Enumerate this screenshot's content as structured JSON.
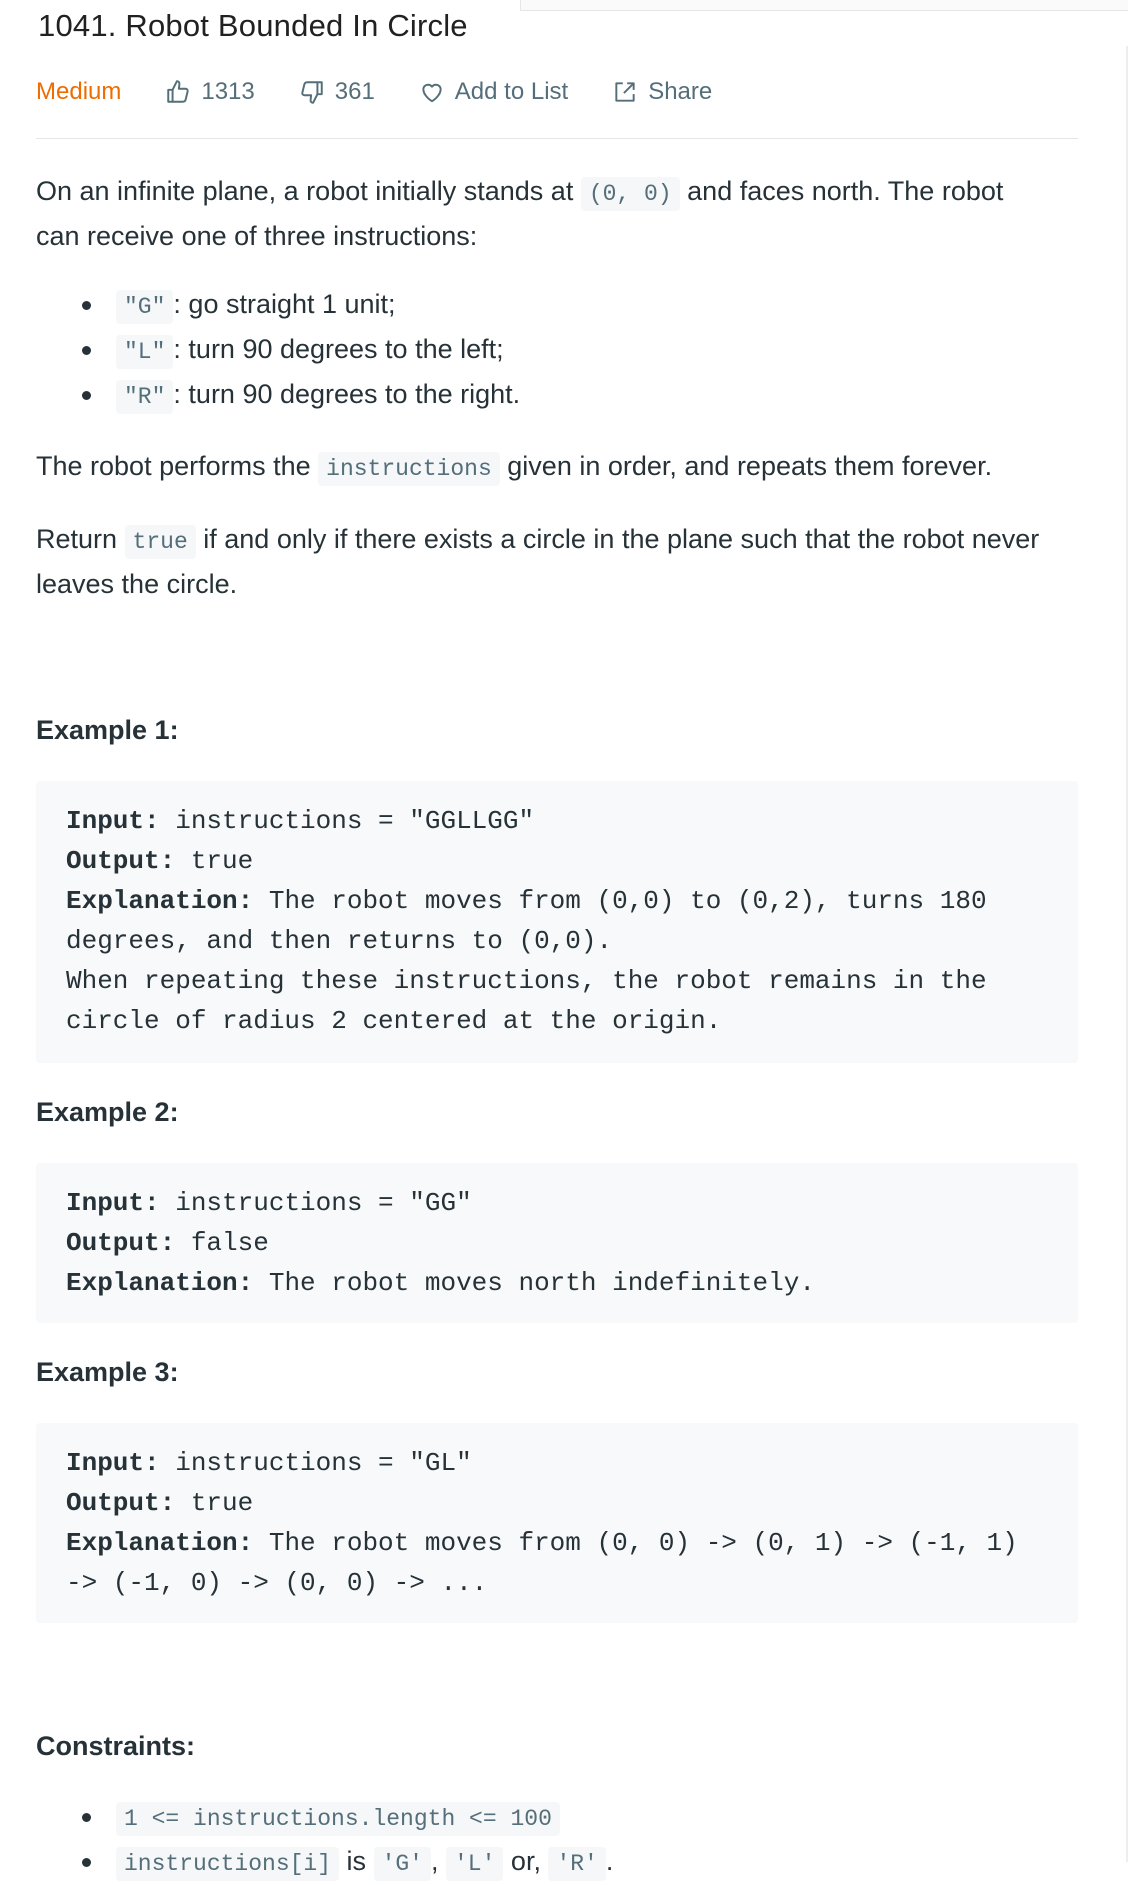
{
  "problem": {
    "title": "1041. Robot Bounded In Circle",
    "difficulty": "Medium",
    "likes": "1313",
    "dislikes": "361",
    "add_to_list": "Add to List",
    "share": "Share"
  },
  "description": {
    "p1_a": "On an infinite plane, a robot initially stands at ",
    "p1_code": "(0, 0)",
    "p1_b": " and faces north. The robot can receive one of three instructions:",
    "instructions": [
      {
        "code": "\"G\"",
        "text": ": go straight 1 unit;"
      },
      {
        "code": "\"L\"",
        "text": ": turn 90 degrees to the left;"
      },
      {
        "code": "\"R\"",
        "text": ": turn 90 degrees to the right."
      }
    ],
    "p2_a": "The robot performs the ",
    "p2_code": "instructions",
    "p2_b": " given in order, and repeats them forever.",
    "p3_a": "Return ",
    "p3_code": "true",
    "p3_b": " if and only if there exists a circle in the plane such that the robot never leaves the circle."
  },
  "examples": [
    {
      "heading": "Example 1:",
      "input_label": "Input:",
      "input": " instructions = \"GGLLGG\"",
      "output_label": "Output:",
      "output": " true",
      "explanation_label": "Explanation:",
      "explanation": " The robot moves from (0,0) to (0,2), turns 180 degrees, and then returns to (0,0).\nWhen repeating these instructions, the robot remains in the circle of radius 2 centered at the origin."
    },
    {
      "heading": "Example 2:",
      "input_label": "Input:",
      "input": " instructions = \"GG\"",
      "output_label": "Output:",
      "output": " false",
      "explanation_label": "Explanation:",
      "explanation": " The robot moves north indefinitely."
    },
    {
      "heading": "Example 3:",
      "input_label": "Input:",
      "input": " instructions = \"GL\"",
      "output_label": "Output:",
      "output": " true",
      "explanation_label": "Explanation:",
      "explanation": " The robot moves from (0, 0) -> (0, 1) -> (-1, 1) -> (-1, 0) -> (0, 0) -> ..."
    }
  ],
  "constraints": {
    "heading": "Constraints:",
    "c1_code": "1 <= instructions.length <= 100",
    "c2_code": "instructions[i]",
    "c2_is": " is ",
    "c2_g": "'G'",
    "c2_comma": ", ",
    "c2_l": "'L'",
    "c2_or": " or, ",
    "c2_r": "'R'",
    "c2_end": "."
  },
  "colors": {
    "difficulty_medium": "#ef6c00",
    "meta_text": "#546e7a",
    "code_bg": "#f7f9fa"
  }
}
